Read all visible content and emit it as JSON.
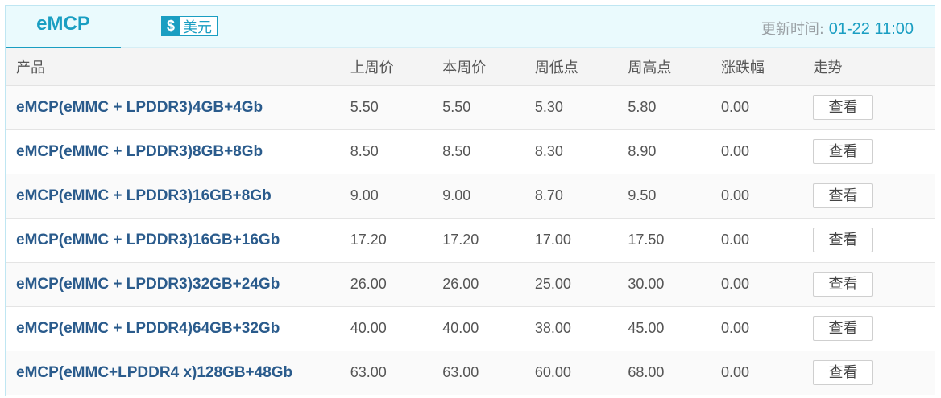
{
  "tabs": {
    "active": "eMCP"
  },
  "currency": {
    "symbol": "$",
    "label": "美元"
  },
  "updated": {
    "label": "更新时间: ",
    "value": "01-22 11:00"
  },
  "table": {
    "headers": [
      "产品",
      "上周价",
      "本周价",
      "周低点",
      "周高点",
      "涨跌幅",
      "走势"
    ],
    "rows": [
      {
        "product": "eMCP(eMMC + LPDDR3)4GB+4Gb",
        "last_week": "5.50",
        "this_week": "5.50",
        "low": "5.30",
        "high": "5.80",
        "change": "0.00",
        "trend_button": "查看"
      },
      {
        "product": "eMCP(eMMC + LPDDR3)8GB+8Gb",
        "last_week": "8.50",
        "this_week": "8.50",
        "low": "8.30",
        "high": "8.90",
        "change": "0.00",
        "trend_button": "查看"
      },
      {
        "product": "eMCP(eMMC + LPDDR3)16GB+8Gb",
        "last_week": "9.00",
        "this_week": "9.00",
        "low": "8.70",
        "high": "9.50",
        "change": "0.00",
        "trend_button": "查看"
      },
      {
        "product": "eMCP(eMMC + LPDDR3)16GB+16Gb",
        "last_week": "17.20",
        "this_week": "17.20",
        "low": "17.00",
        "high": "17.50",
        "change": "0.00",
        "trend_button": "查看"
      },
      {
        "product": "eMCP(eMMC + LPDDR3)32GB+24Gb",
        "last_week": "26.00",
        "this_week": "26.00",
        "low": "25.00",
        "high": "30.00",
        "change": "0.00",
        "trend_button": "查看"
      },
      {
        "product": "eMCP(eMMC + LPDDR4)64GB+32Gb",
        "last_week": "40.00",
        "this_week": "40.00",
        "low": "38.00",
        "high": "45.00",
        "change": "0.00",
        "trend_button": "查看"
      },
      {
        "product": "eMCP(eMMC+LPDDR4 x)128GB+48Gb",
        "last_week": "63.00",
        "this_week": "63.00",
        "low": "60.00",
        "high": "68.00",
        "change": "0.00",
        "trend_button": "查看"
      }
    ]
  },
  "colors": {
    "accent": "#1a9ec2",
    "product_text": "#2a5b8c",
    "tabbar_bg": "#eafafd"
  }
}
